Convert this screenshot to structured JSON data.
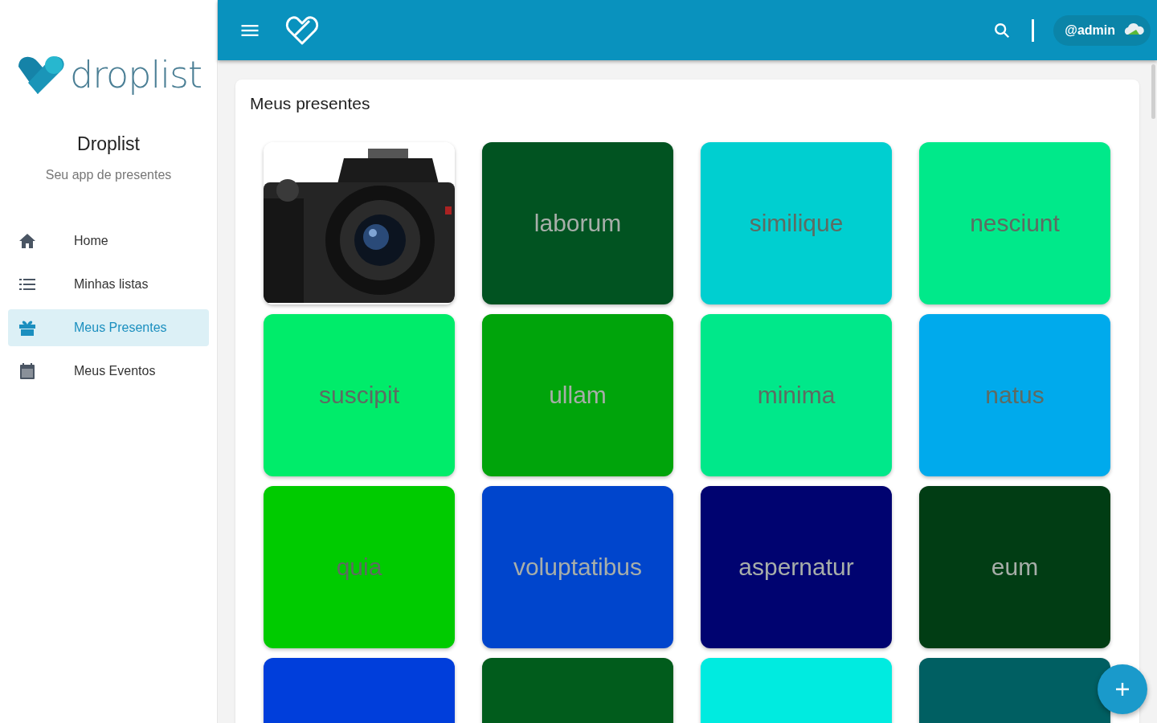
{
  "sidebar": {
    "logo_text": "droplist",
    "app_name": "Droplist",
    "tagline": "Seu app de presentes",
    "items": [
      {
        "label": "Home",
        "selected": false
      },
      {
        "label": "Minhas listas",
        "selected": false
      },
      {
        "label": "Meus Presentes",
        "selected": true
      },
      {
        "label": "Meus Eventos",
        "selected": false
      }
    ]
  },
  "topbar": {
    "user": "@admin"
  },
  "panel": {
    "title": "Meus presentes",
    "gifts": [
      {
        "kind": "picture"
      },
      {
        "kind": "color",
        "label": "laborum",
        "color": "#015321"
      },
      {
        "kind": "color",
        "label": "similique",
        "color": "#00cfd0"
      },
      {
        "kind": "color",
        "label": "nesciunt",
        "color": "#00e98a"
      },
      {
        "kind": "color",
        "label": "suscipit",
        "color": "#00ec6a"
      },
      {
        "kind": "color",
        "label": "ullam",
        "color": "#00a40b"
      },
      {
        "kind": "color",
        "label": "minima",
        "color": "#00e88a"
      },
      {
        "kind": "color",
        "label": "natus",
        "color": "#00aaec"
      },
      {
        "kind": "color",
        "label": "quia",
        "color": "#00cb00"
      },
      {
        "kind": "color",
        "label": "voluptatibus",
        "color": "#0045cc"
      },
      {
        "kind": "color",
        "label": "aspernatur",
        "color": "#000370"
      },
      {
        "kind": "color",
        "label": "eum",
        "color": "#013d14"
      },
      {
        "kind": "color",
        "color": "#003edb"
      },
      {
        "kind": "color",
        "color": "#015c1c"
      },
      {
        "kind": "color",
        "color": "#00ebe0"
      },
      {
        "kind": "color",
        "color": "#005f62"
      }
    ]
  }
}
